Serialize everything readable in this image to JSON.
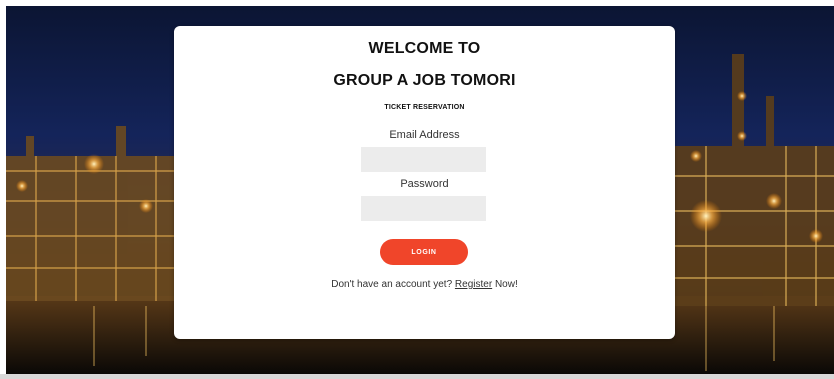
{
  "login_card": {
    "title_line1": "WELCOME TO",
    "title_line2": "GROUP A JOB TOMORI",
    "subtitle": "TICKET RESERVATION",
    "email": {
      "label": "Email Address",
      "value": "",
      "placeholder": ""
    },
    "password": {
      "label": "Password",
      "value": "",
      "placeholder": ""
    },
    "login_button": "LOGIN",
    "register_prompt_before": "Don't have an account yet?",
    "register_link": "Register",
    "register_prompt_after": "Now!"
  },
  "colors": {
    "accent": "#f0452a",
    "input_bg": "#ececec",
    "card_bg": "#ffffff",
    "background_sky": "#14245a"
  }
}
